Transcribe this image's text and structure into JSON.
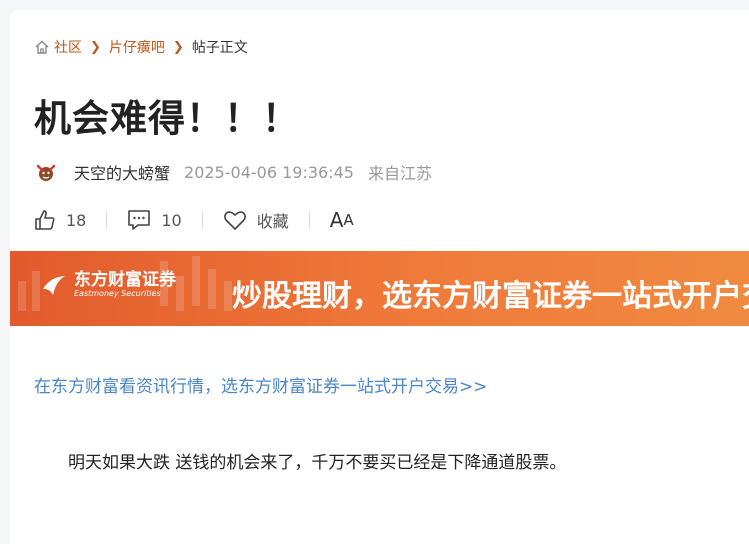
{
  "breadcrumb": {
    "items": [
      {
        "label": "社区"
      },
      {
        "label": "片仔癀吧"
      },
      {
        "label": "帖子正文"
      }
    ]
  },
  "post": {
    "title": "机会难得！！！",
    "author": "天空的大螃蟹",
    "time": "2025-04-06 19:36:45",
    "origin": "来自江苏",
    "body": "明天如果大跌 送钱的机会来了，千万不要买已经是下降通道股票。"
  },
  "actions": {
    "likes": "18",
    "comments": "10",
    "favorite_label": "收藏",
    "font_big": "A",
    "font_small": "A"
  },
  "banner": {
    "brand_cn": "东方财富证券",
    "brand_en": "Eastmoney Securities",
    "slogan": "炒股理财，选东方财富证券一站式开户交易"
  },
  "promo_link": "在东方财富看资讯行情，选东方财富证券一站式开户交易>>",
  "colors": {
    "accent_link": "#c0591b",
    "promo_blue": "#4a86c8",
    "banner_orange": "#e8652f"
  }
}
